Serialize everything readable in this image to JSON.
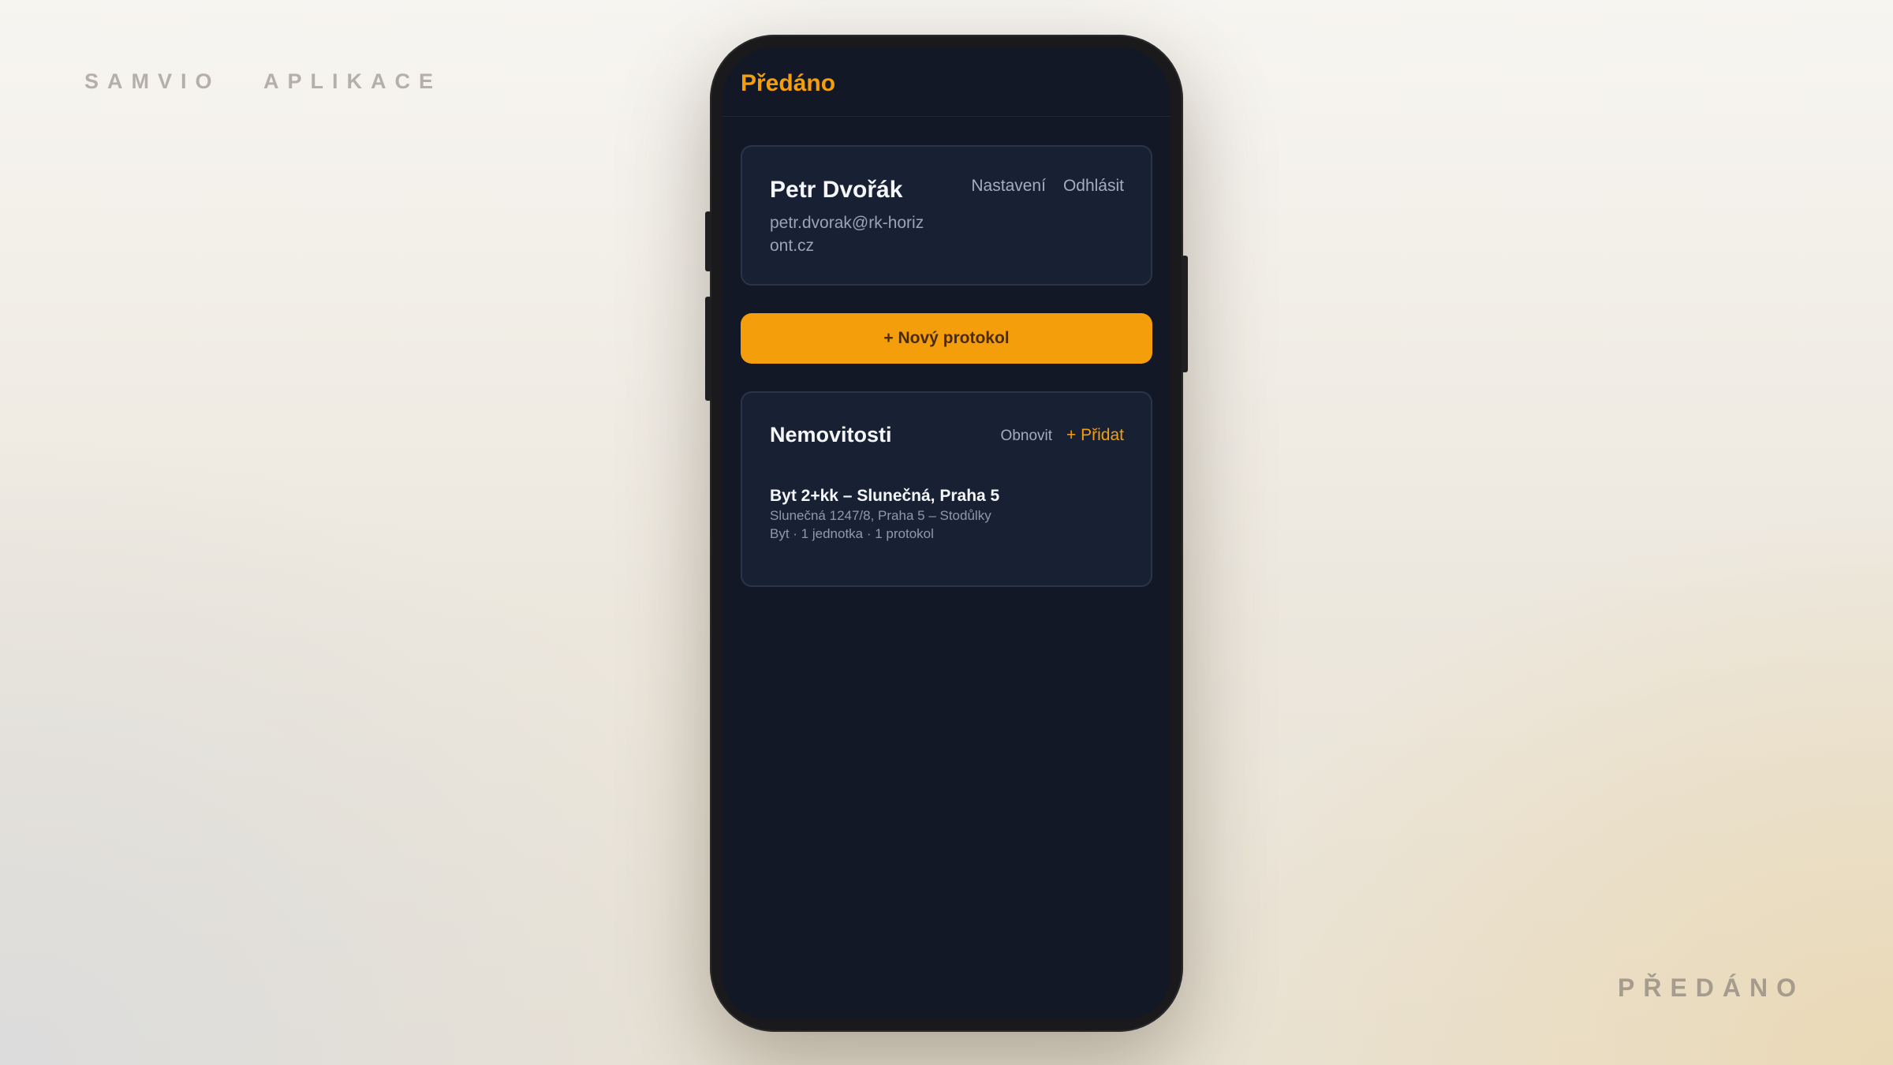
{
  "page": {
    "brand_left": "SAMVIO   APLIKACE",
    "brand_right": "PŘEDÁNO"
  },
  "app": {
    "title": "Předáno",
    "accent_color": "#f59e0b"
  },
  "user": {
    "name": "Petr Dvořák",
    "email": "petr.dvorak@rk-horizont.cz",
    "settings_label": "Nastavení",
    "logout_label": "Odhlásit"
  },
  "actions": {
    "new_protocol_label": "+ Nový protokol"
  },
  "properties": {
    "title": "Nemovitosti",
    "refresh_label": "Obnovit",
    "add_label": "+ Přidat",
    "items": [
      {
        "name": "Byt 2+kk – Slunečná, Praha 5",
        "address": "Slunečná 1247/8, Praha 5 – Stodůlky",
        "meta": "Byt · 1 jednotka · 1 protokol"
      }
    ]
  }
}
